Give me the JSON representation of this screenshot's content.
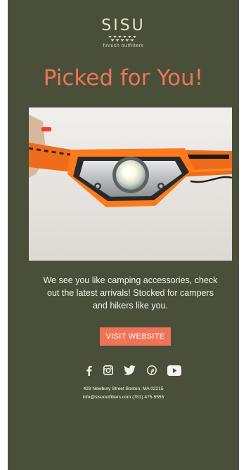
{
  "brand": {
    "name": "SISU",
    "tagline": "finnish outfitters"
  },
  "headline": "Picked for You!",
  "hero": {
    "icon": "headlamp-photo"
  },
  "intro": {
    "text": "We see you like camping accessories, check out the latest arrivals! Stocked for campers and hikers like you."
  },
  "cta": {
    "label": "VISIT WEBSITE"
  },
  "social": {
    "icons": [
      "facebook-icon",
      "instagram-icon",
      "twitter-icon",
      "pinterest-icon",
      "youtube-icon"
    ]
  },
  "footer": {
    "address": "428 Newbury Street Boston, MA 02215",
    "contact": "info@sisuoutfitters.com (781) 475-5555"
  },
  "colors": {
    "background": "#4a4f3a",
    "accent": "#ef7457",
    "brand": "#e8e2c8"
  }
}
